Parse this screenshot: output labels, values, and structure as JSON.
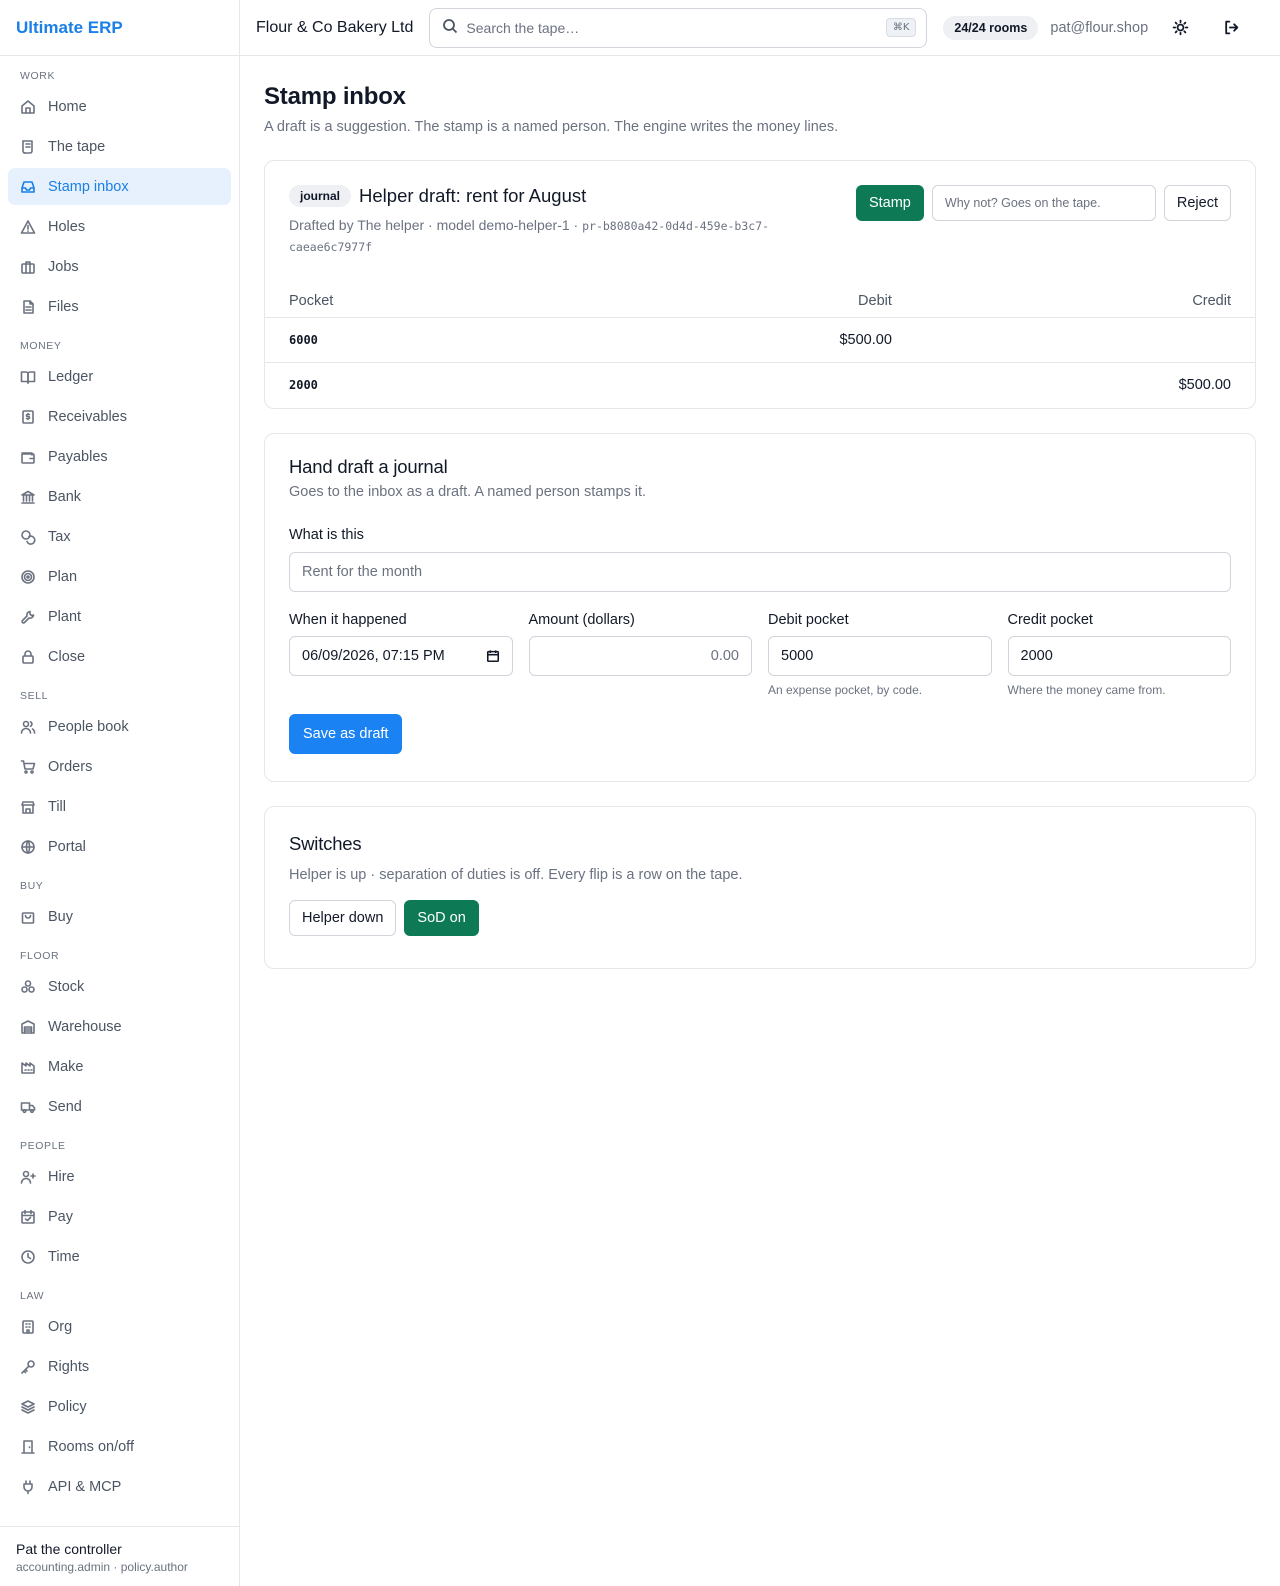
{
  "brand": "Ultimate ERP",
  "company": "Flour & Co Bakery Ltd",
  "search": {
    "placeholder": "Search the tape…",
    "shortcut": "⌘K"
  },
  "rooms_badge": "24/24 rooms",
  "user_email": "pat@flour.shop",
  "sidebar": {
    "sections": {
      "work": "WORK",
      "money": "MONEY",
      "sell": "SELL",
      "buy": "BUY",
      "floor": "FLOOR",
      "people": "PEOPLE",
      "law": "LAW"
    },
    "items": {
      "home": "Home",
      "tape": "The tape",
      "stamp_inbox": "Stamp inbox",
      "holes": "Holes",
      "jobs": "Jobs",
      "files": "Files",
      "ledger": "Ledger",
      "receivables": "Receivables",
      "payables": "Payables",
      "bank": "Bank",
      "tax": "Tax",
      "plan": "Plan",
      "plant": "Plant",
      "close": "Close",
      "people_book": "People book",
      "orders": "Orders",
      "till": "Till",
      "portal": "Portal",
      "buy": "Buy",
      "stock": "Stock",
      "warehouse": "Warehouse",
      "make": "Make",
      "send": "Send",
      "hire": "Hire",
      "pay": "Pay",
      "time": "Time",
      "org": "Org",
      "rights": "Rights",
      "policy": "Policy",
      "rooms": "Rooms on/off",
      "api": "API & MCP"
    },
    "active": "stamp_inbox",
    "user": {
      "name": "Pat the controller",
      "roles": "accounting.admin · policy.author"
    }
  },
  "page": {
    "title": "Stamp inbox",
    "subtitle": "A draft is a suggestion. The stamp is a named person. The engine writes the money lines."
  },
  "draft": {
    "kind": "journal",
    "title": "Helper draft: rent for August",
    "meta": "Drafted by The helper · model demo-helper-1 · ",
    "id": "pr-b8080a42-0d4d-459e-b3c7-caeae6c7977f",
    "stamp_label": "Stamp",
    "reason_placeholder": "Why not? Goes on the tape.",
    "reject_label": "Reject",
    "columns": {
      "pocket": "Pocket",
      "debit": "Debit",
      "credit": "Credit"
    },
    "lines": [
      {
        "pocket": "6000",
        "debit": "$500.00",
        "credit": ""
      },
      {
        "pocket": "2000",
        "debit": "",
        "credit": "$500.00"
      }
    ]
  },
  "hand_draft": {
    "title": "Hand draft a journal",
    "subtitle": "Goes to the inbox as a draft. A named person stamps it.",
    "what_label": "What is this",
    "what_placeholder": "Rent for the month",
    "when_label": "When it happened",
    "when_value": "06/09/2026, 07:15 PM",
    "amount_label": "Amount (dollars)",
    "amount_placeholder": "0.00",
    "debit_label": "Debit pocket",
    "debit_value": "5000",
    "debit_hint": "An expense pocket, by code.",
    "credit_label": "Credit pocket",
    "credit_value": "2000",
    "credit_hint": "Where the money came from.",
    "save_label": "Save as draft"
  },
  "switches": {
    "title": "Switches",
    "subtitle": "Helper is up · separation of duties is off. Every flip is a row on the tape.",
    "helper_label": "Helper down",
    "sod_label": "SoD on"
  },
  "colors": {
    "accent": "#1a7fe6",
    "stamp_green": "#0d7a55",
    "primary_blue": "#1a82f2"
  }
}
